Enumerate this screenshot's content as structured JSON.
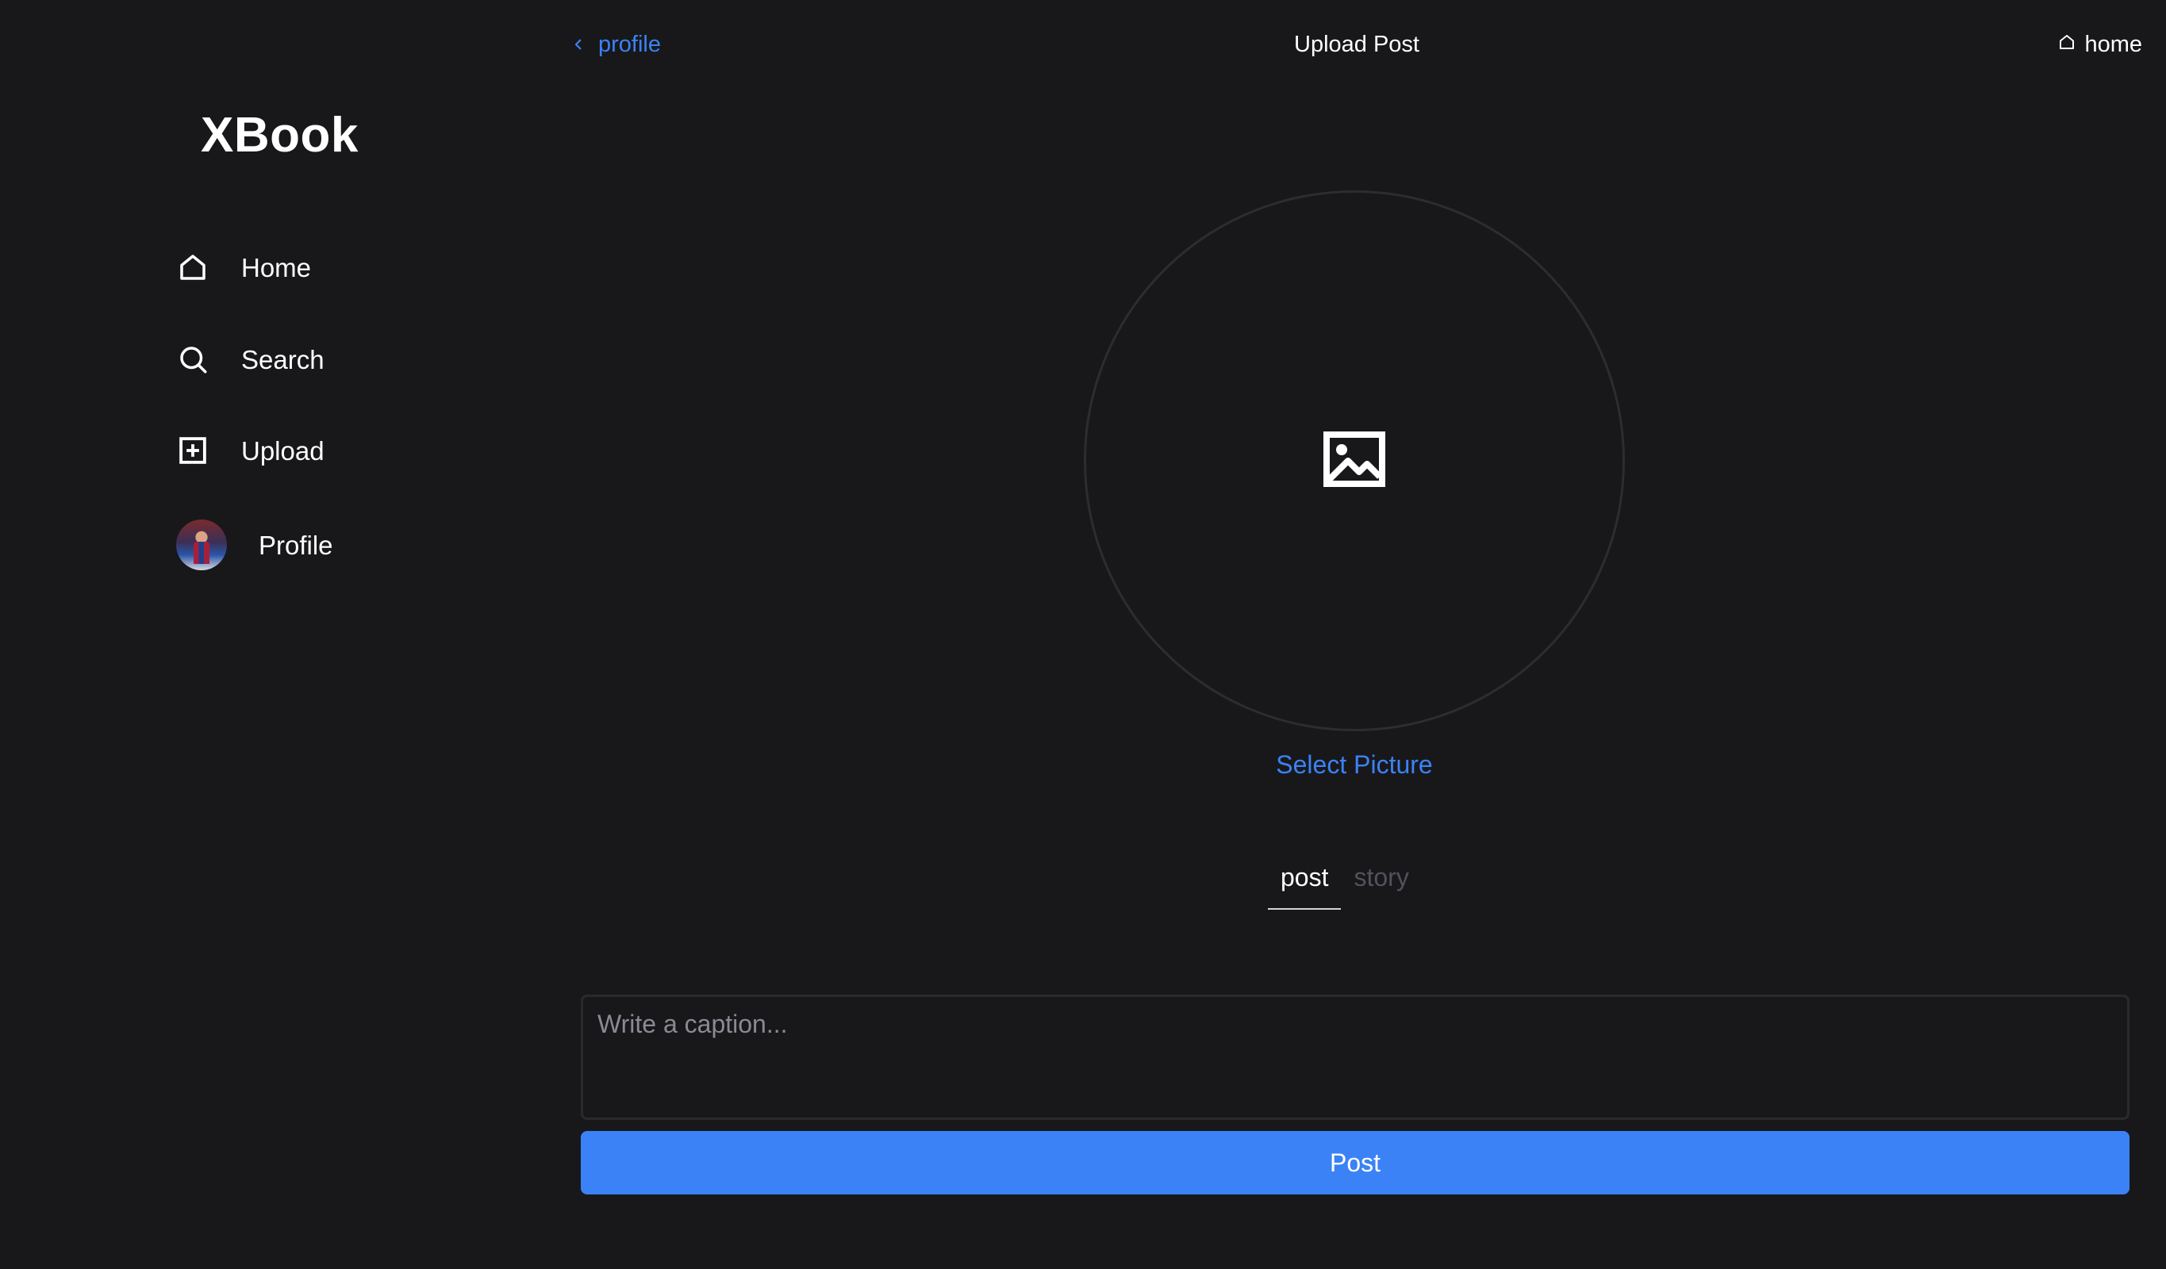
{
  "sidebar": {
    "brand": "XBook",
    "items": [
      {
        "label": "Home",
        "icon": "home-icon"
      },
      {
        "label": "Search",
        "icon": "search-icon"
      },
      {
        "label": "Upload",
        "icon": "plus-square-icon"
      },
      {
        "label": "Profile",
        "icon": "avatar"
      }
    ]
  },
  "topbar": {
    "back_label": "profile",
    "title": "Upload Post",
    "home_label": "home"
  },
  "picture": {
    "icon": "image-icon",
    "select_label": "Select Picture"
  },
  "tabs": [
    {
      "label": "post",
      "active": true
    },
    {
      "label": "story",
      "active": false
    }
  ],
  "caption": {
    "placeholder": "Write a caption...",
    "value": ""
  },
  "post_button": {
    "label": "Post"
  },
  "colors": {
    "background": "#18181b",
    "accent": "#3b82f6",
    "inactive_tab": "#52525b"
  }
}
